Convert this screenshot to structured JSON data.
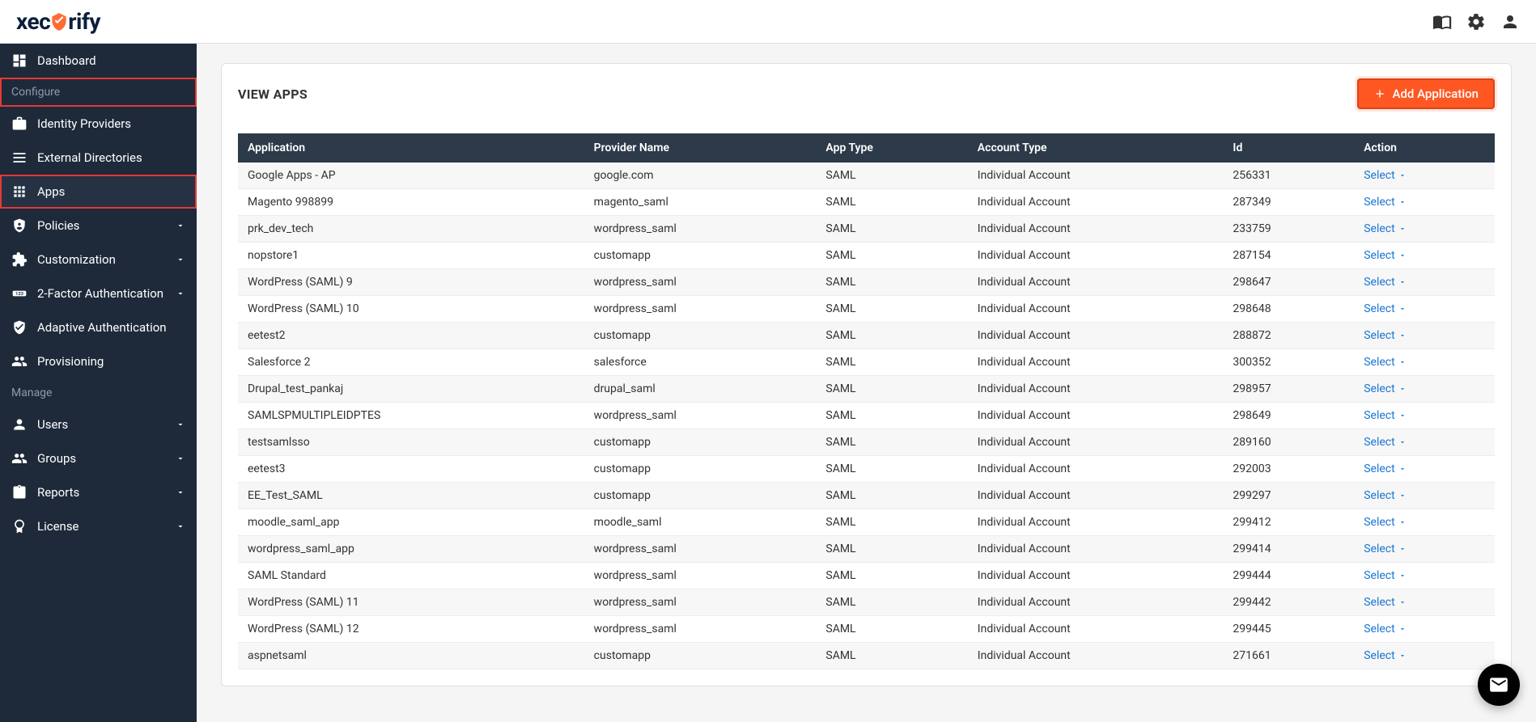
{
  "header": {
    "logo_pre": "xec",
    "logo_post": "rify"
  },
  "sidebar": {
    "items": [
      {
        "label": "Dashboard",
        "icon": "dashboard",
        "expandable": false
      },
      {
        "label": "Configure",
        "icon": null,
        "section": true,
        "highlighted": true
      },
      {
        "label": "Identity Providers",
        "icon": "briefcase",
        "expandable": false
      },
      {
        "label": "External Directories",
        "icon": "list",
        "expandable": false
      },
      {
        "label": "Apps",
        "icon": "apps",
        "expandable": false,
        "active": true,
        "highlighted": true
      },
      {
        "label": "Policies",
        "icon": "shield-gear",
        "expandable": true
      },
      {
        "label": "Customization",
        "icon": "puzzle",
        "expandable": true
      },
      {
        "label": "2-Factor Authentication",
        "icon": "onetwothree",
        "expandable": true
      },
      {
        "label": "Adaptive Authentication",
        "icon": "shield-check",
        "expandable": false
      },
      {
        "label": "Provisioning",
        "icon": "people-arrows",
        "expandable": false
      },
      {
        "label": "Manage",
        "icon": null,
        "section": true
      },
      {
        "label": "Users",
        "icon": "person",
        "expandable": true
      },
      {
        "label": "Groups",
        "icon": "people",
        "expandable": true
      },
      {
        "label": "Reports",
        "icon": "clipboard",
        "expandable": true
      },
      {
        "label": "License",
        "icon": "badge",
        "expandable": true
      }
    ]
  },
  "main": {
    "title": "VIEW APPS",
    "add_button": "Add Application",
    "columns": [
      "Application",
      "Provider Name",
      "App Type",
      "Account Type",
      "Id",
      "Action"
    ],
    "action_label": "Select",
    "rows": [
      {
        "application": "Google Apps - AP",
        "provider": "google.com",
        "apptype": "SAML",
        "account": "Individual Account",
        "id": "256331"
      },
      {
        "application": "Magento 998899",
        "provider": "magento_saml",
        "apptype": "SAML",
        "account": "Individual Account",
        "id": "287349"
      },
      {
        "application": "prk_dev_tech",
        "provider": "wordpress_saml",
        "apptype": "SAML",
        "account": "Individual Account",
        "id": "233759"
      },
      {
        "application": "nopstore1",
        "provider": "customapp",
        "apptype": "SAML",
        "account": "Individual Account",
        "id": "287154"
      },
      {
        "application": "WordPress (SAML) 9",
        "provider": "wordpress_saml",
        "apptype": "SAML",
        "account": "Individual Account",
        "id": "298647"
      },
      {
        "application": "WordPress (SAML) 10",
        "provider": "wordpress_saml",
        "apptype": "SAML",
        "account": "Individual Account",
        "id": "298648"
      },
      {
        "application": "eetest2",
        "provider": "customapp",
        "apptype": "SAML",
        "account": "Individual Account",
        "id": "288872"
      },
      {
        "application": "Salesforce 2",
        "provider": "salesforce",
        "apptype": "SAML",
        "account": "Individual Account",
        "id": "300352"
      },
      {
        "application": "Drupal_test_pankaj",
        "provider": "drupal_saml",
        "apptype": "SAML",
        "account": "Individual Account",
        "id": "298957"
      },
      {
        "application": "SAMLSPMULTIPLEIDPTES",
        "provider": "wordpress_saml",
        "apptype": "SAML",
        "account": "Individual Account",
        "id": "298649"
      },
      {
        "application": "testsamlsso",
        "provider": "customapp",
        "apptype": "SAML",
        "account": "Individual Account",
        "id": "289160"
      },
      {
        "application": "eetest3",
        "provider": "customapp",
        "apptype": "SAML",
        "account": "Individual Account",
        "id": "292003"
      },
      {
        "application": "EE_Test_SAML",
        "provider": "customapp",
        "apptype": "SAML",
        "account": "Individual Account",
        "id": "299297"
      },
      {
        "application": "moodle_saml_app",
        "provider": "moodle_saml",
        "apptype": "SAML",
        "account": "Individual Account",
        "id": "299412"
      },
      {
        "application": "wordpress_saml_app",
        "provider": "wordpress_saml",
        "apptype": "SAML",
        "account": "Individual Account",
        "id": "299414"
      },
      {
        "application": "SAML Standard",
        "provider": "wordpress_saml",
        "apptype": "SAML",
        "account": "Individual Account",
        "id": "299444"
      },
      {
        "application": "WordPress (SAML) 11",
        "provider": "wordpress_saml",
        "apptype": "SAML",
        "account": "Individual Account",
        "id": "299442"
      },
      {
        "application": "WordPress (SAML) 12",
        "provider": "wordpress_saml",
        "apptype": "SAML",
        "account": "Individual Account",
        "id": "299445"
      },
      {
        "application": "aspnetsaml",
        "provider": "customapp",
        "apptype": "SAML",
        "account": "Individual Account",
        "id": "271661"
      }
    ]
  }
}
